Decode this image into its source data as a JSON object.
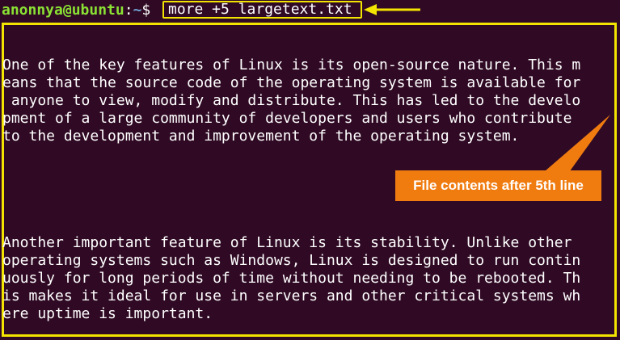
{
  "prompt": {
    "user_host": "anonnya@ubuntu",
    "separator": ":",
    "path": "~",
    "symbol": "$ "
  },
  "command": "more +5 largetext.txt",
  "output_lines": [
    "One of the key features of Linux is its open-source nature. This m",
    "eans that the source code of the operating system is available for",
    " anyone to view, modify and distribute. This has led to the develo",
    "pment of a large community of developers and users who contribute",
    "to the development and improvement of the operating system.",
    "",
    "",
    "",
    "",
    "",
    "Another important feature of Linux is its stability. Unlike other",
    "operating systems such as Windows, Linux is designed to run contin",
    "uously for long periods of time without needing to be rebooted. Th",
    "is makes it ideal for use in servers and other critical systems wh",
    "ere uptime is important."
  ],
  "annotation": {
    "label": "File contents after 5th line",
    "highlight_color": "#f2e300",
    "callout_color": "#f07c10"
  }
}
